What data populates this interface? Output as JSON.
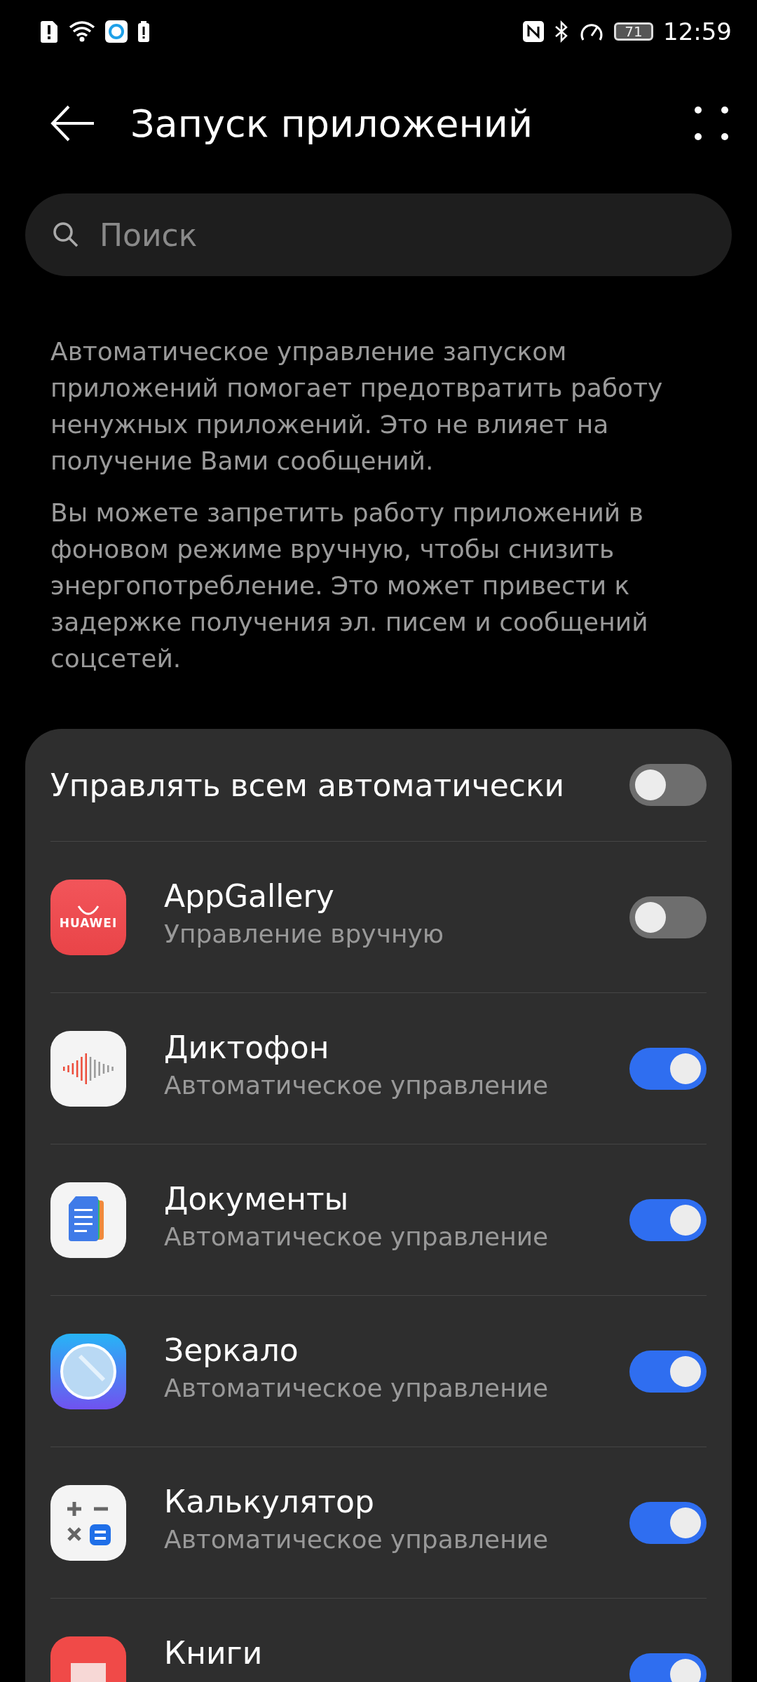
{
  "status_bar": {
    "battery": "71",
    "time": "12:59"
  },
  "header": {
    "title": "Запуск приложений"
  },
  "search": {
    "placeholder": "Поиск"
  },
  "description": [
    "Автоматическое управление запуском приложений помогает предотвратить работу ненужных приложений. Это не влияет на получение Вами сообщений.",
    "Вы можете запретить работу приложений в фоновом режиме вручную, чтобы снизить энергопотребление. Это может привести к задержке получения эл. писем и сообщений соцсетей."
  ],
  "master": {
    "label": "Управлять всем автоматически",
    "on": false
  },
  "apps": [
    {
      "kind": "appgallery",
      "name": "AppGallery",
      "icon_text": "HUAWEI",
      "status": "Управление вручную",
      "on": false
    },
    {
      "kind": "recorder",
      "name": "Диктофон",
      "status": "Автоматическое управление",
      "on": true
    },
    {
      "kind": "docs",
      "name": "Документы",
      "status": "Автоматическое управление",
      "on": true
    },
    {
      "kind": "mirror",
      "name": "Зеркало",
      "status": "Автоматическое управление",
      "on": true
    },
    {
      "kind": "calculator",
      "name": "Калькулятор",
      "status": "Автоматическое управление",
      "on": true
    },
    {
      "kind": "books",
      "name": "Книги",
      "on": true
    }
  ]
}
